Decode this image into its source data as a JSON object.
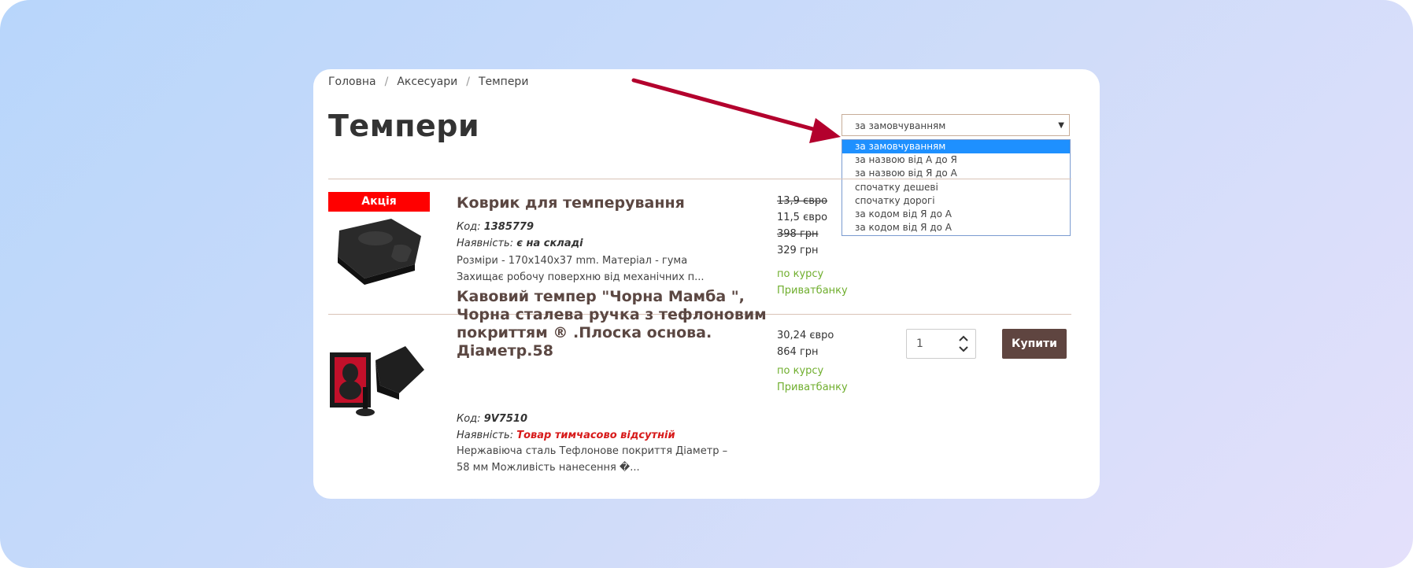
{
  "breadcrumb": {
    "home": "Головна",
    "accessories": "Аксесуари",
    "current": "Темпери"
  },
  "page_title": "Темпери",
  "sort": {
    "selected": "за замовчуванням",
    "options": [
      "за замовчуванням",
      "за назвою від А до Я",
      "за назвою від Я до А",
      "спочатку дешеві",
      "спочатку дорогі",
      "за кодом від Я до А",
      "за кодом від Я до А"
    ]
  },
  "products": [
    {
      "badge": "Акція",
      "title": "Коврик для темперування",
      "code_label": "Код:",
      "code": "1385779",
      "availability_label": "Наявність:",
      "availability": "є на складі",
      "description": "Розміри - 170x140x37 mm. Матеріал - гума Захищає робочу поверхню від механічних п...",
      "old_price_eur": "13,9 євро",
      "price_eur": "11,5 євро",
      "old_price_uah": "398 грн",
      "price_uah": "329 грн",
      "rate_note_1": "по курсу",
      "rate_note_2": "Приватбанку"
    },
    {
      "title_lines": [
        "Кавовий темпер \"Чорна Мамба \",",
        "Чорна сталева ручка з тефлоновим",
        "покриттям ® .Плоска основа.",
        "Діаметр.58"
      ],
      "code_label": "Код:",
      "code": "9V7510",
      "availability_label": "Наявність:",
      "availability": "Товар тимчасово відсутній",
      "description": "Нержавіюча сталь Тефлонове покриття Діаметр – 58 мм Можливість нанесення �...",
      "price_eur": "30,24 євро",
      "price_uah": "864 грн",
      "rate_note_1": "по курсу",
      "rate_note_2": "Приватбанку",
      "quantity": "1",
      "buy_label": "Купити"
    }
  ],
  "colors": {
    "accent_brown": "#5f4540",
    "sale_red": "#ff0000",
    "rate_green": "#6fae2d",
    "arrow_red": "#b3002d"
  }
}
